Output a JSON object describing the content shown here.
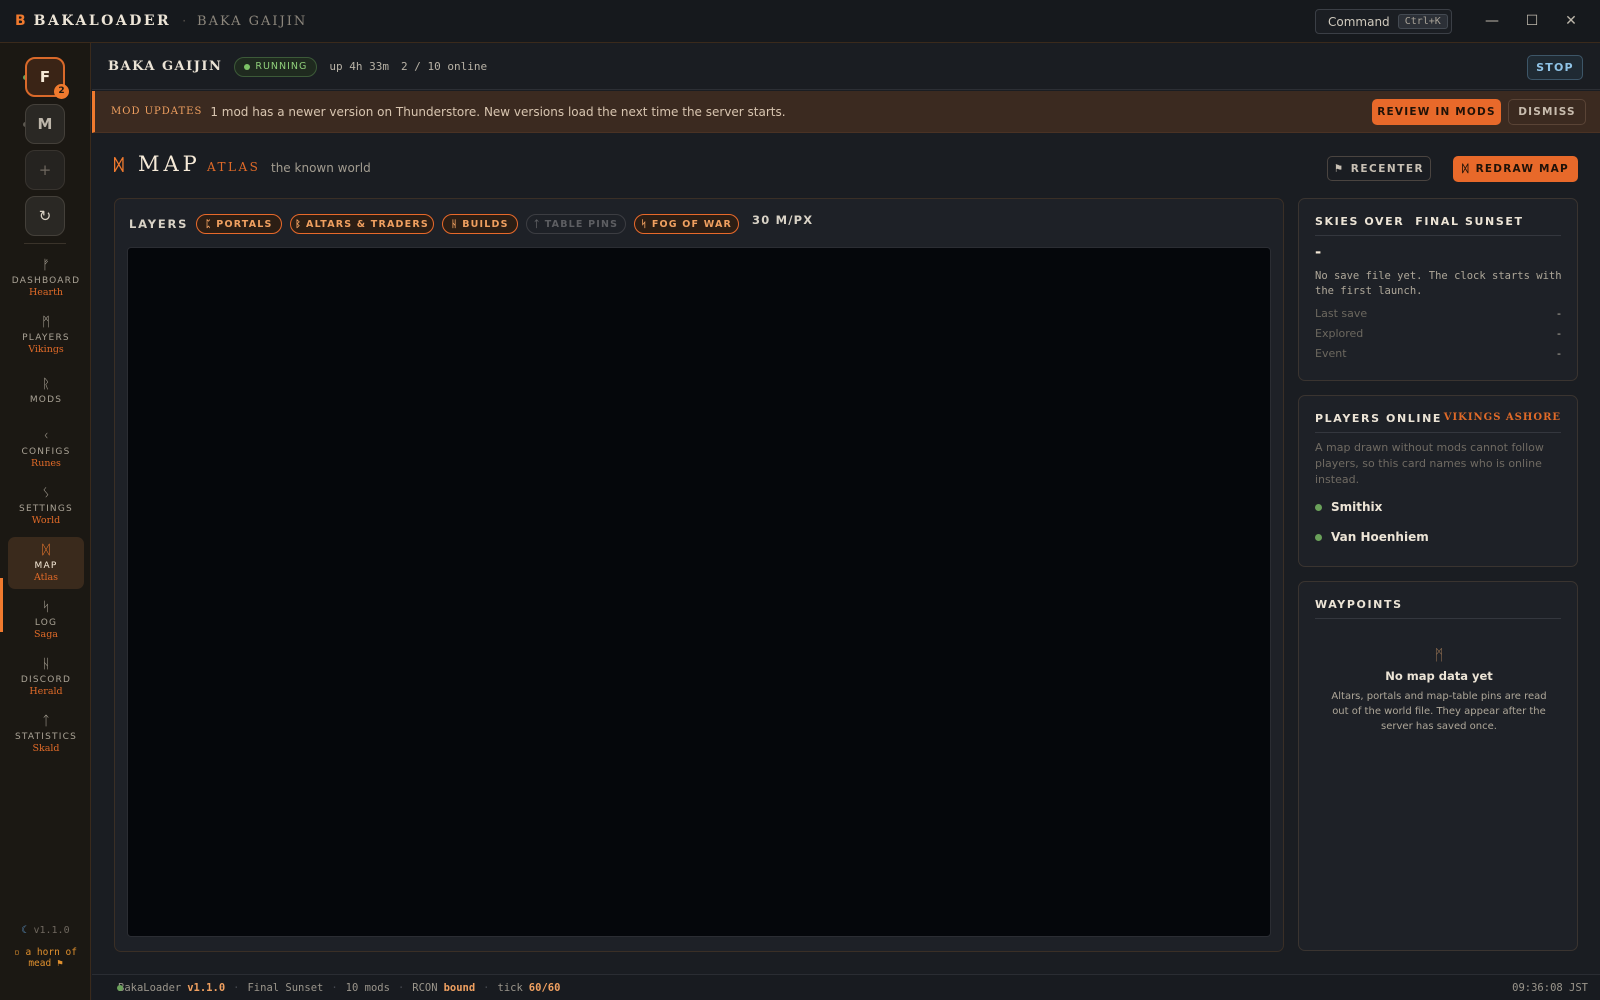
{
  "titlebar": {
    "app_logo": "B",
    "app_name": "BAKALOADER",
    "separator": "·",
    "server_title": "BAKA GAIJIN",
    "command_label": "Command",
    "command_shortcut": "Ctrl+K",
    "minimize": "—",
    "maximize": "☐",
    "close": "✕"
  },
  "sidebar": {
    "servers": [
      {
        "initial": "F",
        "badge": "2"
      },
      {
        "initial": "M"
      }
    ],
    "add_glyph": "+",
    "refresh_glyph": "↻",
    "nav": [
      {
        "rune": "ᚠ",
        "label": "DASHBOARD",
        "sub": "Hearth"
      },
      {
        "rune": "ᛗ",
        "label": "PLAYERS",
        "sub": "Vikings"
      },
      {
        "rune": "ᚱ",
        "label": "MODS",
        "sub": ""
      },
      {
        "rune": "ᚲ",
        "label": "CONFIGS",
        "sub": "Runes"
      },
      {
        "rune": "ᛊ",
        "label": "SETTINGS",
        "sub": "World"
      },
      {
        "rune": "ᛞ",
        "label": "MAP",
        "sub": "Atlas"
      },
      {
        "rune": "ᛋ",
        "label": "LOG",
        "sub": "Saga"
      },
      {
        "rune": "ᚺ",
        "label": "DISCORD",
        "sub": "Herald"
      },
      {
        "rune": "ᛏ",
        "label": "STATISTICS",
        "sub": "Skald"
      }
    ],
    "version": "v1.1.0",
    "footer_note": "a horn of mead"
  },
  "server_header": {
    "name": "BAKA GAIJIN",
    "status": "RUNNING",
    "uptime": "up 4h 33m",
    "online": "2 / 10 online",
    "stop_label": "STOP"
  },
  "banner": {
    "label": "MOD UPDATES",
    "text": "1 mod has a newer version on Thunderstore. New versions load the next time the server starts.",
    "review_label": "REVIEW IN MODS",
    "dismiss_label": "DISMISS"
  },
  "page": {
    "rune": "ᛞ",
    "title": "MAP",
    "subtitle": "ATLAS",
    "description": "the known world",
    "recenter_label": "RECENTER",
    "redraw_label": "REDRAW MAP"
  },
  "map": {
    "layers_label": "LAYERS",
    "layers": [
      {
        "glyph": "ᛈ",
        "label": "PORTALS",
        "enabled": true
      },
      {
        "glyph": "ᛒ",
        "label": "ALTARS & TRADERS",
        "enabled": true
      },
      {
        "glyph": "ᚺ",
        "label": "BUILDS",
        "enabled": true
      },
      {
        "glyph": "ᛏ",
        "label": "TABLE PINS",
        "enabled": false
      },
      {
        "glyph": "ᛋ",
        "label": "FOG OF WAR",
        "enabled": true
      }
    ],
    "scale": "30 M/PX"
  },
  "skies": {
    "title": "SKIES OVER  FINAL SUNSET",
    "value": "-",
    "note": "No save file yet. The clock starts with the first launch.",
    "rows": [
      {
        "key": "Last save",
        "value": "-"
      },
      {
        "key": "Explored",
        "value": "-"
      },
      {
        "key": "Event",
        "value": "-"
      }
    ]
  },
  "players_online": {
    "title": "PLAYERS ONLINE",
    "subtitle": "VIKINGS ASHORE",
    "note": "A map drawn without mods cannot follow players, so this card names who is online instead.",
    "players": [
      "Smithix",
      "Van Hoenhiem"
    ]
  },
  "waypoints": {
    "title": "WAYPOINTS",
    "rune": "ᛗ",
    "empty_title": "No map data yet",
    "empty_text": "Altars, portals and map-table pins are read out of the world file. They appear after the server has saved once."
  },
  "statusbar": {
    "app": "BakaLoader",
    "version": "v1.1.0",
    "world": "Final Sunset",
    "mods": "10 mods",
    "rcon_label": "RCON",
    "rcon_value": "bound",
    "tick_label": "tick",
    "tick_value": "60/60",
    "clock": "09:36:08 JST"
  },
  "colors": {
    "accent": "#f07a2e",
    "background": "#1a1d22",
    "map_background": "#05070b",
    "running_green": "#7cc266"
  }
}
